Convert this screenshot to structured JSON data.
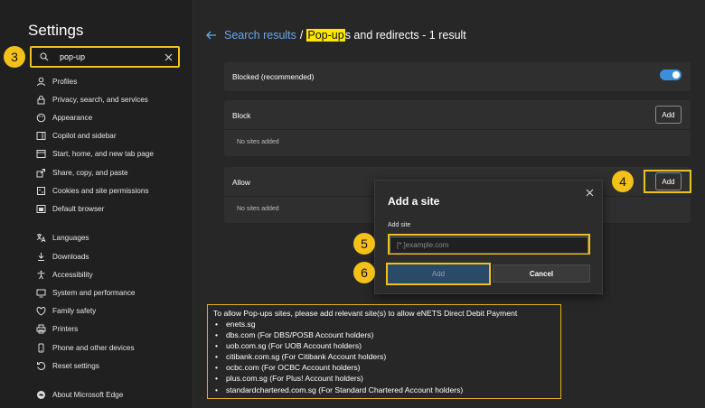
{
  "sidebar": {
    "title": "Settings",
    "search_value": "pop-up",
    "items": [
      {
        "label": "Profiles",
        "icon": "profile-icon"
      },
      {
        "label": "Privacy, search, and services",
        "icon": "lock-icon"
      },
      {
        "label": "Appearance",
        "icon": "palette-icon"
      },
      {
        "label": "Copilot and sidebar",
        "icon": "sidebar-icon"
      },
      {
        "label": "Start, home, and new tab page",
        "icon": "home-icon"
      },
      {
        "label": "Share, copy, and paste",
        "icon": "share-icon"
      },
      {
        "label": "Cookies and site permissions",
        "icon": "cookies-icon"
      },
      {
        "label": "Default browser",
        "icon": "browser-icon"
      },
      {
        "label": "Languages",
        "icon": "languages-icon"
      },
      {
        "label": "Downloads",
        "icon": "download-icon"
      },
      {
        "label": "Accessibility",
        "icon": "accessibility-icon"
      },
      {
        "label": "System and performance",
        "icon": "system-icon"
      },
      {
        "label": "Family safety",
        "icon": "family-icon"
      },
      {
        "label": "Printers",
        "icon": "printer-icon"
      },
      {
        "label": "Phone and other devices",
        "icon": "phone-icon"
      },
      {
        "label": "Reset settings",
        "icon": "reset-icon"
      },
      {
        "label": "About Microsoft Edge",
        "icon": "edge-icon"
      }
    ]
  },
  "callouts": {
    "c3": "3",
    "c4": "4",
    "c5": "5",
    "c6": "6"
  },
  "breadcrumb": {
    "link": "Search results",
    "separator": "/",
    "title_highlight": "Pop-up",
    "title_rest": "s and redirects - 1 result"
  },
  "blocked": {
    "label": "Blocked (recommended)",
    "enabled": true
  },
  "block": {
    "label": "Block",
    "add_label": "Add",
    "empty": "No sites added"
  },
  "allow": {
    "label": "Allow",
    "add_label": "Add",
    "empty": "No sites added"
  },
  "dialog": {
    "title": "Add a site",
    "field_label": "Add site",
    "placeholder": "[*.]example.com",
    "add_label": "Add",
    "cancel_label": "Cancel"
  },
  "note": {
    "intro": "To allow Pop-ups sites, please add relevant site(s) to allow eNETS Direct Debit Payment",
    "items": [
      "enets.sg",
      "dbs.com (For DBS/POSB Account holders)",
      "uob.com.sg (For UOB Account holders)",
      "citibank.com.sg (For Citibank Account holders)",
      "ocbc.com (For OCBC Account holders)",
      "plus.com.sg (For Plus! Account holders)",
      "standardchartered.com.sg (For Standard Chartered Account holders)"
    ]
  },
  "colors": {
    "accent": "#3b8fd9",
    "highlight": "#ffe600",
    "callout": "#f3c11a"
  }
}
